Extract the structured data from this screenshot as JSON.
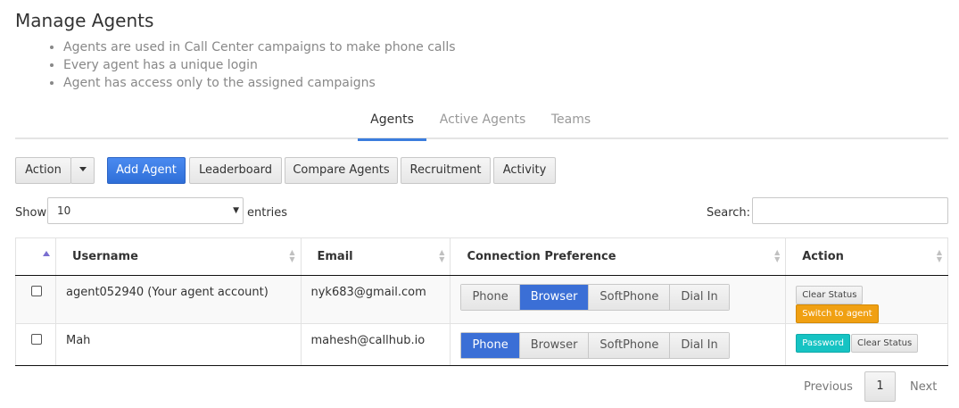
{
  "page": {
    "title": "Manage Agents",
    "bullets": [
      "Agents are used in Call Center campaigns to make phone calls",
      "Every agent has a unique login",
      "Agent has access only to the assigned campaigns"
    ]
  },
  "tabs": [
    {
      "label": "Agents",
      "active": true
    },
    {
      "label": "Active Agents",
      "active": false
    },
    {
      "label": "Teams",
      "active": false
    }
  ],
  "toolbar": {
    "action_label": "Action",
    "add_agent_label": "Add Agent",
    "leaderboard_label": "Leaderboard",
    "compare_label": "Compare Agents",
    "recruitment_label": "Recruitment",
    "activity_label": "Activity"
  },
  "controls": {
    "show_label": "Show",
    "entries_value": "10",
    "entries_label": "entries",
    "search_label": "Search:",
    "search_value": ""
  },
  "table": {
    "columns": [
      "Username",
      "Email",
      "Connection Preference",
      "Action"
    ],
    "rows": [
      {
        "username": "agent052940 (Your agent account)",
        "email": "nyk683@gmail.com",
        "prefs": [
          "Phone",
          "Browser",
          "SoftPhone",
          "Dial In"
        ],
        "selected_pref": "Browser",
        "actions": [
          "Clear Status",
          "Switch to agent"
        ]
      },
      {
        "username": "Mah",
        "email": "mahesh@callhub.io",
        "prefs": [
          "Phone",
          "Browser",
          "SoftPhone",
          "Dial In"
        ],
        "selected_pref": "Phone",
        "actions": [
          "Password",
          "Clear Status"
        ]
      }
    ]
  },
  "pagination": {
    "previous_label": "Previous",
    "page": "1",
    "next_label": "Next"
  },
  "colors": {
    "primary": "#3b7ddd",
    "orange": "#f0a012",
    "teal": "#16c3c3"
  }
}
